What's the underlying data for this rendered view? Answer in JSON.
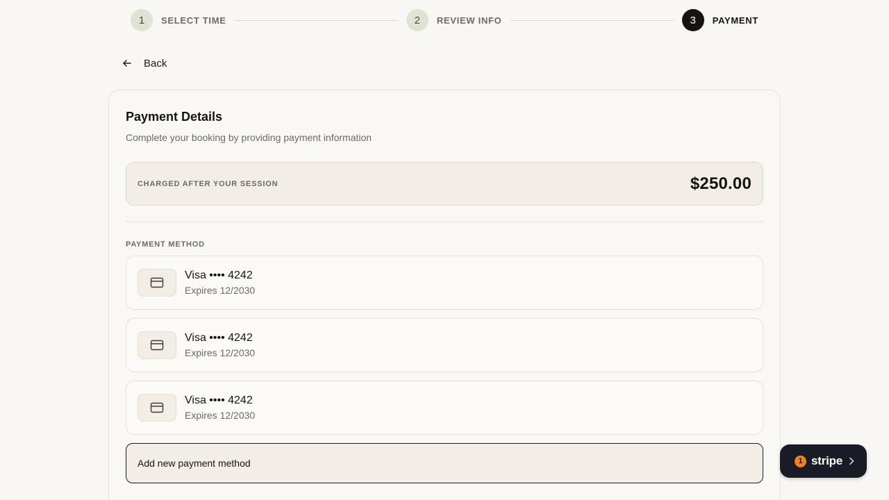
{
  "stepper": {
    "steps": [
      {
        "num": "1",
        "label": "SELECT TIME"
      },
      {
        "num": "2",
        "label": "REVIEW INFO"
      },
      {
        "num": "3",
        "label": "PAYMENT"
      }
    ],
    "active_step": 3
  },
  "nav": {
    "back_label": "Back",
    "back_icon": "arrow-left-icon"
  },
  "payment": {
    "title": "Payment Details",
    "subtitle": "Complete your booking by providing payment information",
    "charge_label": "CHARGED AFTER YOUR SESSION",
    "charge_amount": "$250.00",
    "method_section_label": "PAYMENT METHOD",
    "methods": [
      {
        "name": "Visa •••• 4242",
        "expires": "Expires 12/2030",
        "icon": "credit-card-icon"
      },
      {
        "name": "Visa •••• 4242",
        "expires": "Expires 12/2030",
        "icon": "credit-card-icon"
      },
      {
        "name": "Visa •••• 4242",
        "expires": "Expires 12/2030",
        "icon": "credit-card-icon"
      }
    ],
    "add_method_label": "Add new payment method"
  },
  "stripe_widget": {
    "badge_count": "1",
    "brand": "stripe",
    "icon": "chevron-right-icon"
  },
  "colors": {
    "background": "#f8f7f3",
    "accent_dark": "#16140f",
    "step_inactive_bg": "#dfe3d2",
    "charge_box_bg": "#f2ede5",
    "stripe_bg": "#191c26",
    "stripe_badge": "#f0841a"
  }
}
